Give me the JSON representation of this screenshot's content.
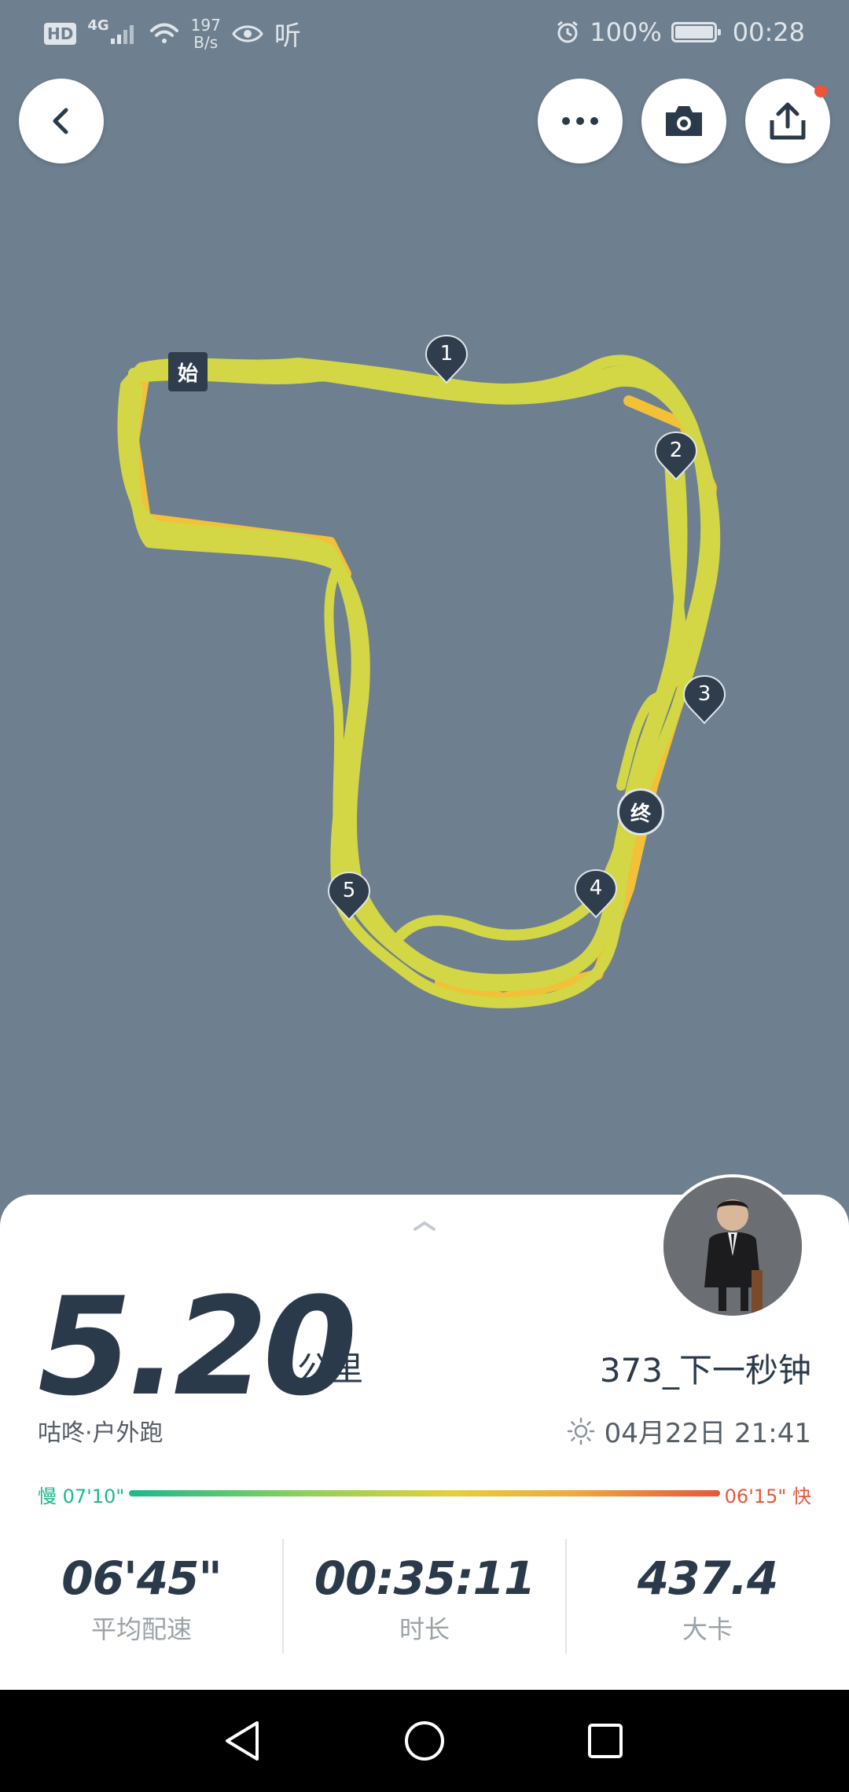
{
  "status_bar": {
    "hd": "HD",
    "network": "4G",
    "speed_value": "197",
    "speed_unit": "B/s",
    "listen_label": "听",
    "battery": "100%",
    "time": "00:28",
    "battery_level": 1.0
  },
  "map": {
    "start_label": "始",
    "end_label": "终",
    "km_markers": [
      "1",
      "2",
      "3",
      "4",
      "5"
    ],
    "route_color": "#d3d645",
    "fast_segment_color": "#f2c137"
  },
  "toolbar": {
    "back_icon": "chevron-left-icon",
    "more_icon": "more-horizontal-icon",
    "camera_icon": "camera-icon",
    "share_icon": "share-icon"
  },
  "summary": {
    "distance": "5.20",
    "distance_unit": "公里",
    "activity_type": "咕咚·户外跑",
    "username": "373_下一秒钟",
    "date": "04月22日 21:41",
    "weather_icon": "sun-icon"
  },
  "pace": {
    "slow_label": "慢 07'10\"",
    "fast_label": "06'15\" 快",
    "slow_color": "#1bb98d",
    "fast_color": "#e5573c"
  },
  "stats": [
    {
      "value": "06'45\"",
      "label": "平均配速"
    },
    {
      "value": "00:35:11",
      "label": "时长"
    },
    {
      "value": "437.4",
      "label": "大卡"
    }
  ]
}
